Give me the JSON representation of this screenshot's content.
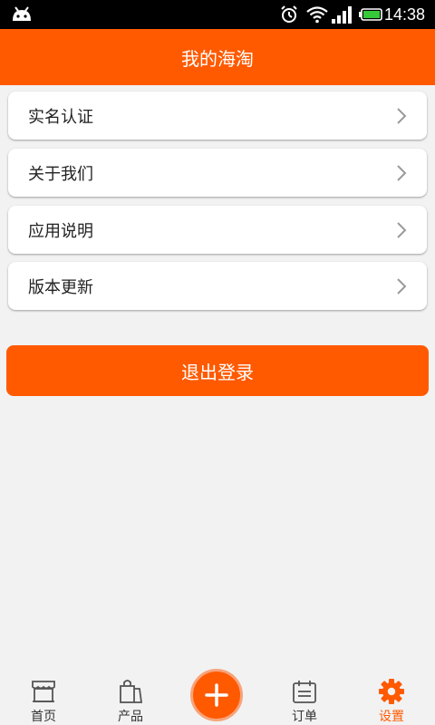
{
  "status_bar": {
    "time": "14:38"
  },
  "header": {
    "title": "我的海淘"
  },
  "menu": [
    {
      "label": "实名认证"
    },
    {
      "label": "关于我们"
    },
    {
      "label": "应用说明"
    },
    {
      "label": "版本更新"
    }
  ],
  "logout_label": "退出登录",
  "tabs": [
    {
      "label": "首页",
      "icon": "storefront-icon"
    },
    {
      "label": "产品",
      "icon": "shopping-bag-icon"
    },
    {
      "label": "订单",
      "icon": "calendar-icon"
    },
    {
      "label": "设置",
      "icon": "gear-icon",
      "active": true
    }
  ],
  "colors": {
    "accent": "#ff5a00",
    "background": "#f2f2f2"
  }
}
